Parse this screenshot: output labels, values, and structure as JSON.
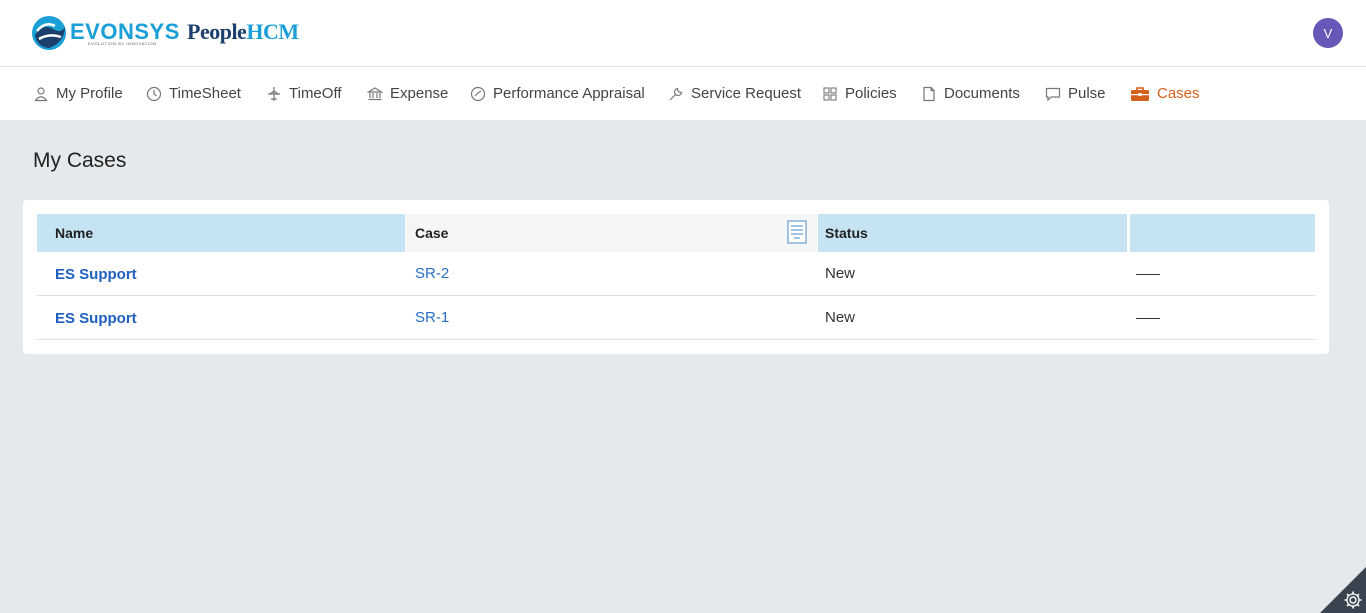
{
  "header": {
    "brand_name": "EVONSYS",
    "brand_tagline": "EVOLUTION BY INNOVATION",
    "product_name_part1": "People",
    "product_name_part2": "HCM",
    "avatar_initial": "V"
  },
  "nav": {
    "items": [
      {
        "label": "My Profile",
        "icon": "user-icon"
      },
      {
        "label": "TimeSheet",
        "icon": "clock-icon"
      },
      {
        "label": "TimeOff",
        "icon": "plane-icon"
      },
      {
        "label": "Expense",
        "icon": "bank-icon"
      },
      {
        "label": "Performance Appraisal",
        "icon": "gauge-icon"
      },
      {
        "label": "Service Request",
        "icon": "wrench-icon"
      },
      {
        "label": "Policies",
        "icon": "grid-icon"
      },
      {
        "label": "Documents",
        "icon": "document-icon"
      },
      {
        "label": "Pulse",
        "icon": "chat-icon"
      },
      {
        "label": "Cases",
        "icon": "briefcase-icon"
      }
    ],
    "active": "Cases",
    "active_color": "#d35f1a"
  },
  "main": {
    "title": "My Cases",
    "table": {
      "columns": [
        "Name",
        "Case",
        "Status",
        ""
      ],
      "rows": [
        {
          "name": "ES Support",
          "case": "SR-2",
          "status": "New"
        },
        {
          "name": "ES Support",
          "case": "SR-1",
          "status": "New"
        }
      ]
    }
  },
  "colors": {
    "accent": "#1a9fd6",
    "header_cell_bg": "#c5e3f2",
    "link": "#1f5fbf",
    "page_bg": "#e5e9ec"
  }
}
